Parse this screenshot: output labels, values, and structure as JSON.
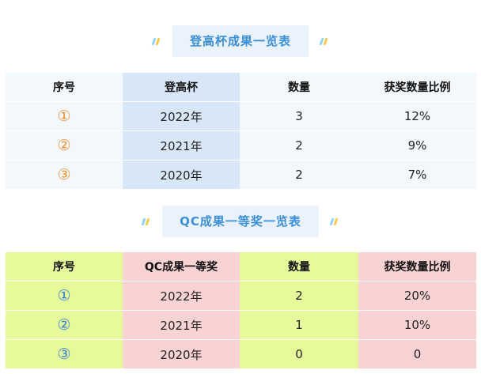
{
  "section1": {
    "title": "登高杯成果一览表",
    "headers": [
      "序号",
      "登高杯",
      "数量",
      "获奖数量比例"
    ],
    "rows": [
      [
        "①",
        "2022年",
        "3",
        "12%"
      ],
      [
        "②",
        "2021年",
        "2",
        "9%"
      ],
      [
        "③",
        "2020年",
        "2",
        "7%"
      ]
    ]
  },
  "section2": {
    "title": "QC成果一等奖一览表",
    "headers": [
      "序号",
      "QC成果一等奖",
      "数量",
      "获奖数量比例"
    ],
    "rows": [
      [
        "①",
        "2022年",
        "2",
        "20%"
      ],
      [
        "②",
        "2021年",
        "1",
        "10%"
      ],
      [
        "③",
        "2020年",
        "0",
        "0"
      ]
    ]
  },
  "colors": {
    "title_text": "#3b8fd6",
    "title_bg": "#eaf2fc",
    "t1_light": "#f3f8fc",
    "t1_blue": "#d7e7f7",
    "t1_circle": "#f0923a",
    "t2_green": "#e6f99b",
    "t2_pink": "#f9d3d4",
    "t2_circle": "#3a84d6"
  }
}
